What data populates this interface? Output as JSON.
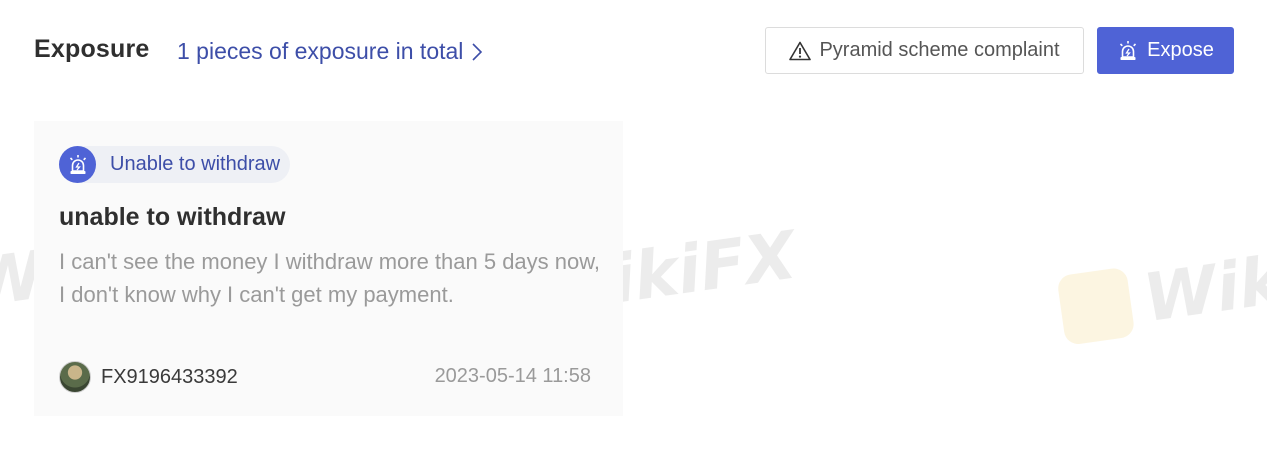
{
  "header": {
    "title": "Exposure",
    "total_link": "1 pieces of exposure in total",
    "complaint_button": "Pyramid scheme complaint",
    "expose_button": "Expose"
  },
  "card": {
    "tag": "Unable to withdraw",
    "title": "unable to withdraw",
    "body": "I can't see the money I withdraw more than 5 days now, I don't know why I can't get my payment.",
    "author": "FX9196433392",
    "timestamp": "2023-05-14 11:58"
  },
  "watermark": {
    "text_left": "WikiFX",
    "text_center": "WikiFX",
    "text_right": "Wiki"
  },
  "colors": {
    "accent": "#4f63d6",
    "link": "#3d4ea8",
    "muted_text": "#9a9a9a",
    "card_bg": "#fafafa"
  },
  "icons": {
    "chevron": "chevron-right-icon",
    "warning": "warning-triangle-icon",
    "alarm": "alarm-light-icon",
    "avatar": "user-avatar"
  }
}
